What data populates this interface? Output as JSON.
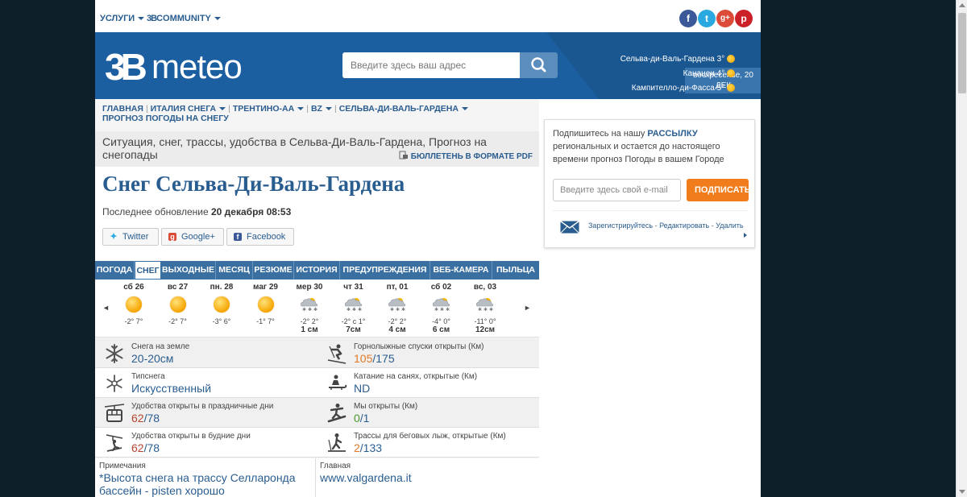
{
  "topbar": {
    "services": "УСЛУГИ",
    "community": "COMMUNITY",
    "community_mark": "3B",
    "social": [
      {
        "name": "facebook",
        "glyph": "f",
        "color": "#3b5998"
      },
      {
        "name": "twitter",
        "glyph": "t",
        "color": "#2aa9e0"
      },
      {
        "name": "google-plus",
        "glyph": "g+",
        "color": "#dc4a38"
      },
      {
        "name": "pinterest",
        "glyph": "p",
        "color": "#cb2027"
      }
    ]
  },
  "header": {
    "logo_mark": "3B",
    "logo_word": "meteo",
    "search_placeholder": "Введите здесь ваш адрес",
    "date": "воскресенье, 20 ДЕК",
    "cities": [
      {
        "name": "Сельва-ди-Валь-Гардена",
        "temp": "3°",
        "icon": "sun-icon"
      },
      {
        "name": "Канацеи",
        "temp": "4°",
        "icon": "sun-icon"
      },
      {
        "name": "Кампителло-ди-Фасса",
        "temp": "5°",
        "icon": "sun-icon"
      }
    ]
  },
  "breadcrumbs": {
    "line1": [
      "ГЛАВНАЯ",
      "ИТАЛИЯ СНЕГА",
      "ТРЕНТИНО-АА",
      "BZ",
      "СЕЛЬВА-ДИ-ВАЛЬ-ГАРДЕНА"
    ],
    "line2": "ПРОГНОЗ ПОГОДЫ НА СНЕГУ",
    "separator": "|"
  },
  "subtitle": {
    "text": "Ситуация, снег, трассы, удобства в Сельва-Ди-Валь-Гардена, Прогноз на снегопады",
    "pdf": "БЮЛЛЕТЕНЬ В ФОРМАТЕ PDF"
  },
  "page_title": "Снег Сельва-Ди-Валь-Гардена",
  "updated": {
    "label": "Последнее обновление",
    "value": "20 декабря 08:53"
  },
  "share": {
    "twitter": "Twitter",
    "google": "Google+",
    "facebook": "Facebook"
  },
  "tabs": [
    "ПОГОДА",
    "СНЕГ",
    "ВЫХОДНЫЕ",
    "МЕСЯЦ",
    "РЕЗЮМЕ",
    "ИСТОРИЯ",
    "ПРЕДУПРЕЖДЕНИЯ",
    "ВЕБ-КАМЕРА",
    "ПЫЛЬЦА"
  ],
  "active_tab": "СНЕГ",
  "forecast": {
    "prev": "◄",
    "next": "►",
    "days": [
      {
        "day": "сб 26",
        "icon": "sun",
        "temp": "-2° 7°",
        "snow": ""
      },
      {
        "day": "вс 27",
        "icon": "sun",
        "temp": "-2° 7°",
        "snow": ""
      },
      {
        "day": "пн. 28",
        "icon": "sun",
        "temp": "-3° 6°",
        "snow": ""
      },
      {
        "day": "маг 29",
        "icon": "sun",
        "temp": "-1° 7°",
        "snow": ""
      },
      {
        "day": "мер 30",
        "icon": "snow",
        "temp": "-2° 2°",
        "snow": "1 см"
      },
      {
        "day": "чт 31",
        "icon": "snow",
        "temp": "-2° с 1°",
        "snow": "7см"
      },
      {
        "day": "пт, 01",
        "icon": "snow",
        "temp": "-2° 2°",
        "snow": "4 см"
      },
      {
        "day": "сб 02",
        "icon": "snow",
        "temp": "-4° 0°",
        "snow": "6 см"
      },
      {
        "day": "вс, 03",
        "icon": "snow",
        "temp": "-11° 0°",
        "snow": "12см"
      }
    ]
  },
  "stats": {
    "snow_ground": {
      "label": "Снега на земле",
      "value": "20-20см"
    },
    "slopes_open": {
      "label": "Горнолыжные спуски открыты (Км)",
      "open": "105",
      "total": "/175"
    },
    "snow_type": {
      "label": "Типснега",
      "value": "Искусственный"
    },
    "sled_open": {
      "label": "Катание на санях, открытые (Км)",
      "value": "ND"
    },
    "lifts_holiday": {
      "label": "Удобства открыты в праздничные дни",
      "open": "62",
      "total": "/78"
    },
    "snowpark": {
      "label": "Мы открыты (Км)",
      "open": "0",
      "total": "/1"
    },
    "lifts_weekday": {
      "label": "Удобства открыты в будние дни",
      "open": "62",
      "total": "/78"
    },
    "xc_open": {
      "label": "Трассы для беговых лыж, открытые (Км)",
      "open": "2",
      "total": "/133"
    }
  },
  "notes": {
    "label": "Примечания",
    "text": "*Высота снега на трассу Селларонда бассейн",
    "sep": " - ",
    "link": "pisten хорошо",
    "main_label": "Главная",
    "main_link": "www.valgardena.it"
  },
  "newsletter": {
    "text_before": "Подпишитесь на нашу",
    "highlight": "РАССЫЛКУ",
    "text_after": "региональных и остается до настоящего времени прогноз Погоды в вашем Городе",
    "email_placeholder": "Введите здесь свой e-mail",
    "subscribe": "ПОДПИСАТЬСЯ",
    "links": [
      "Зарегистрируйтесь",
      "Редактировать",
      "Удалить"
    ],
    "link_sep": " - "
  },
  "colors": {
    "brand_blue": "#1c5fa0",
    "link_blue": "#2a5d8f",
    "accent_orange": "#f07c1c"
  }
}
